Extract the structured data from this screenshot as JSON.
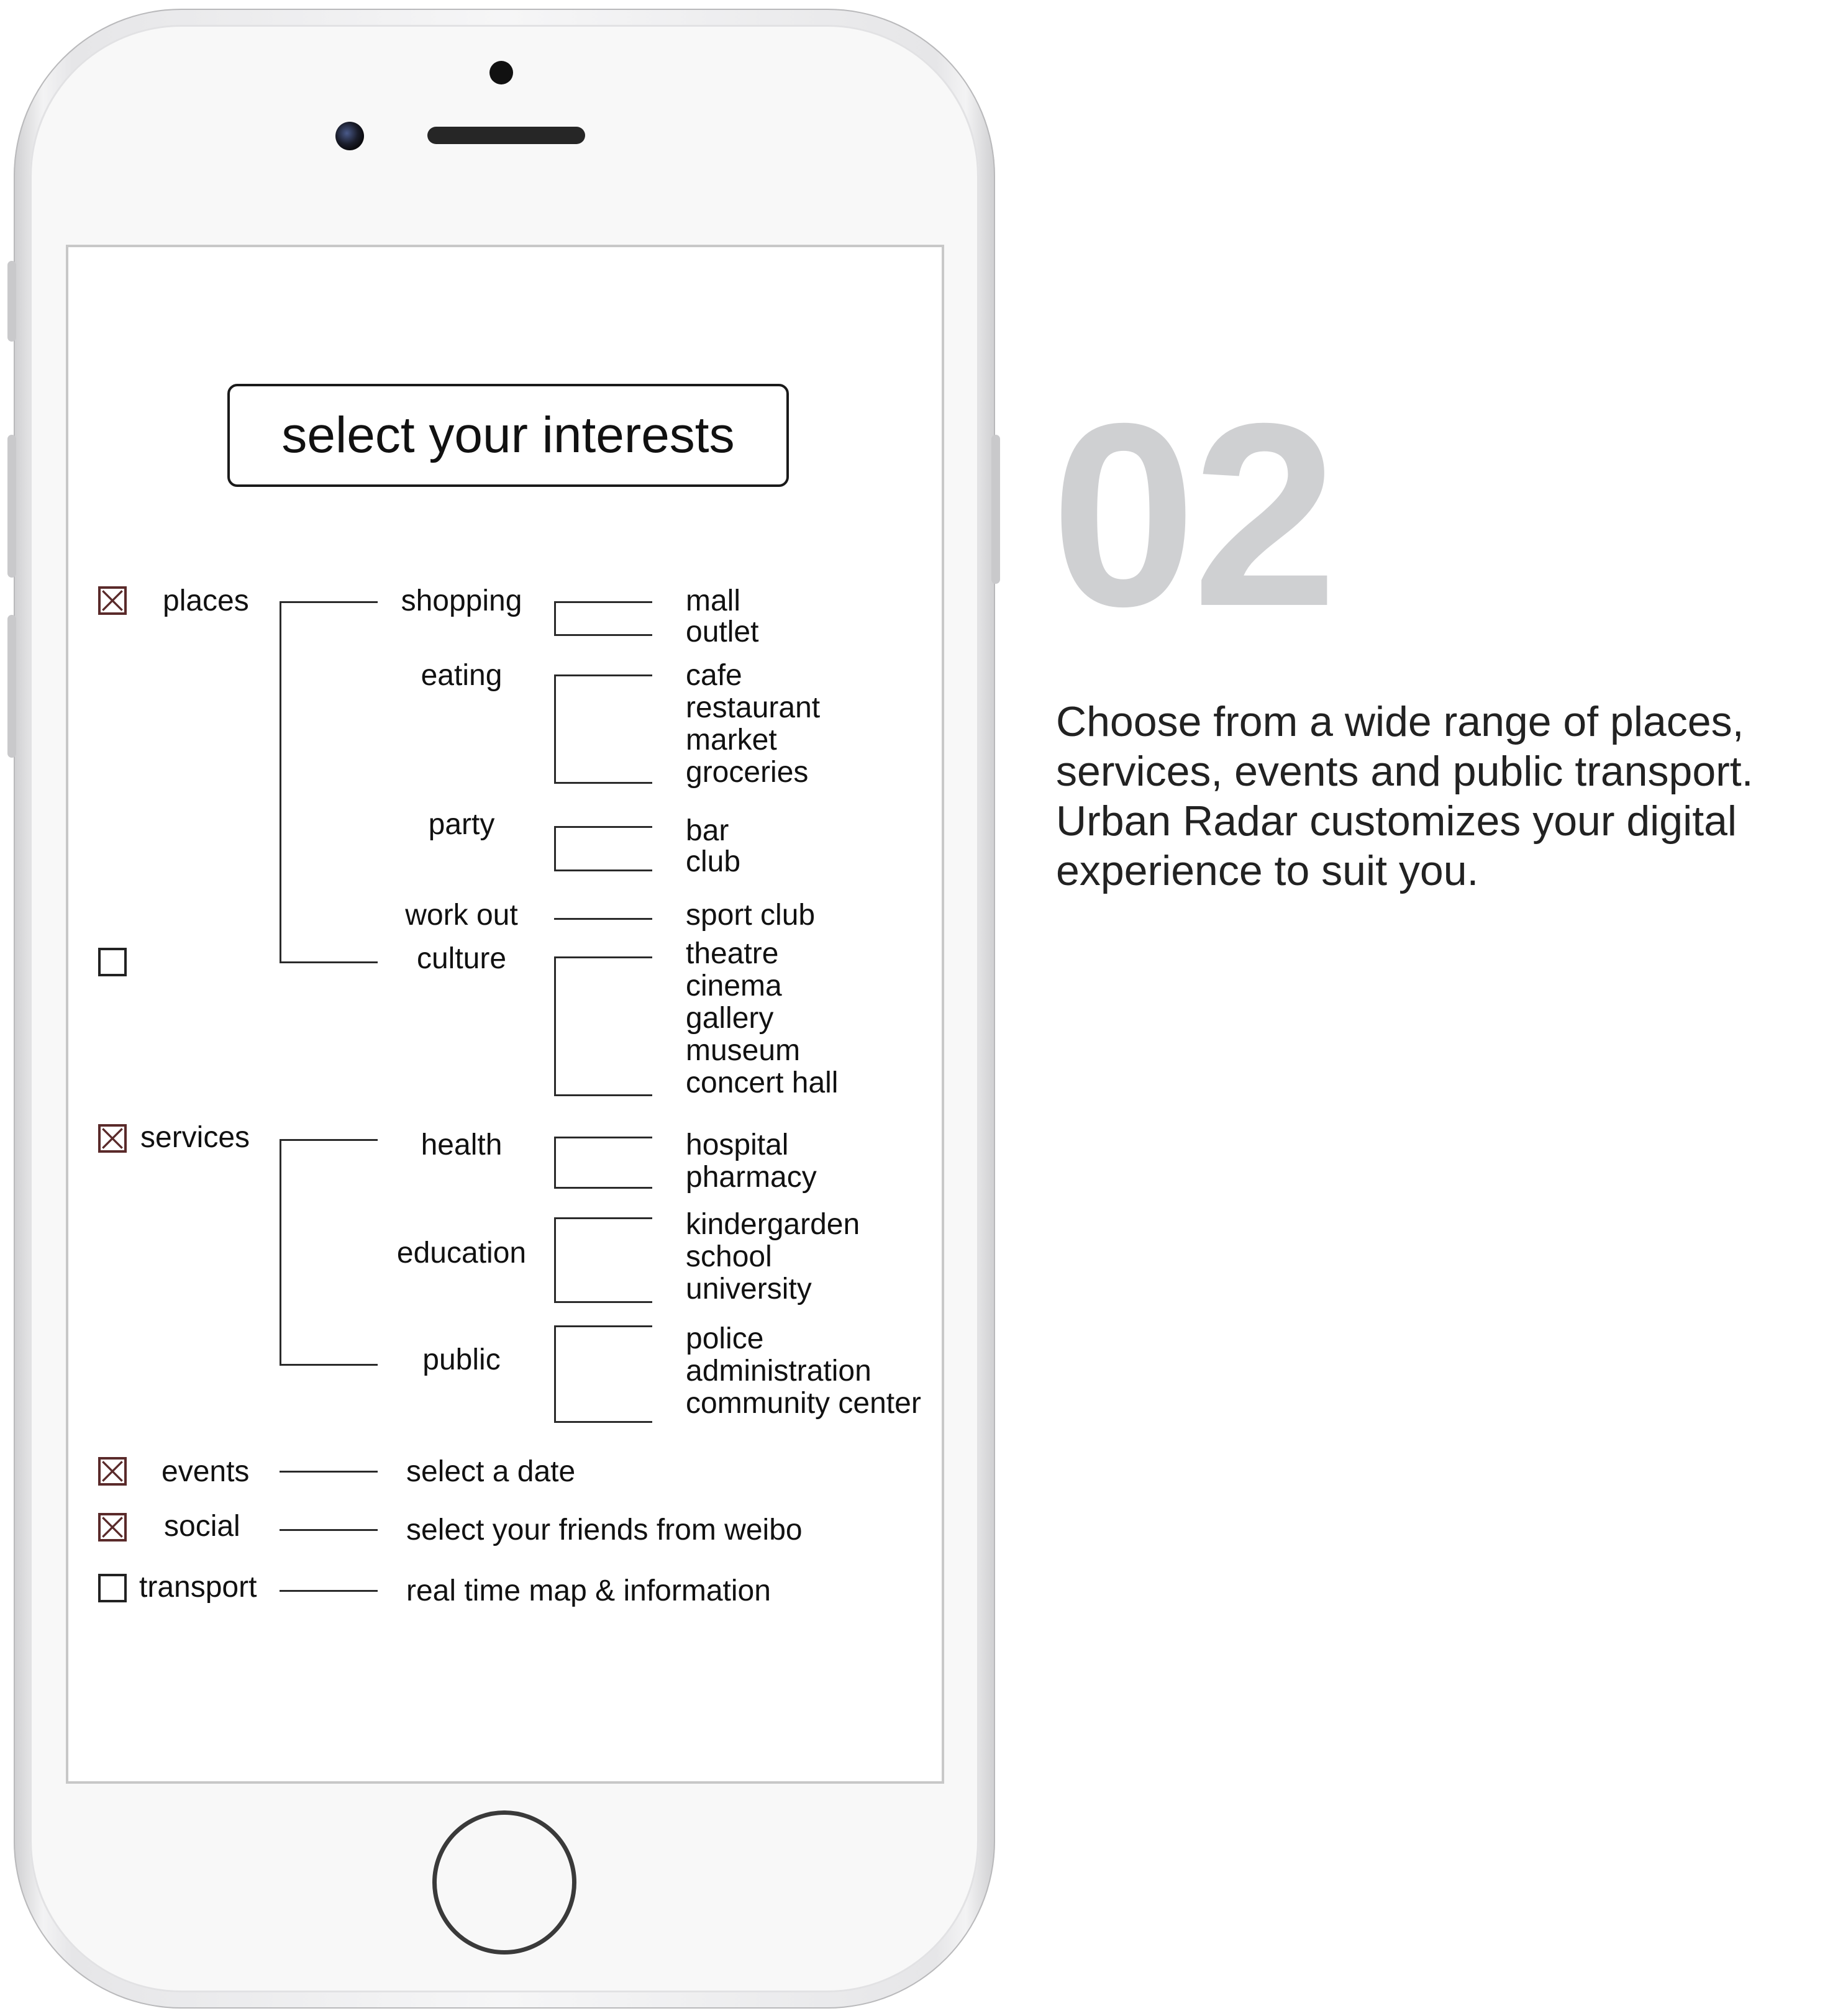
{
  "screen": {
    "title": "select your interests",
    "categories": [
      {
        "label": "places",
        "checked": true,
        "subcategories": [
          {
            "label": "shopping",
            "items": [
              "mall",
              "outlet"
            ]
          },
          {
            "label": "eating",
            "items": [
              "cafe",
              "restaurant",
              "market",
              "groceries"
            ]
          },
          {
            "label": "party",
            "items": [
              "bar",
              "club"
            ]
          },
          {
            "label": "work out",
            "items": [
              "sport club"
            ]
          },
          {
            "label": "culture",
            "items": [
              "theatre",
              "cinema",
              "gallery",
              "museum",
              "concert hall"
            ]
          }
        ]
      },
      {
        "label": "",
        "checked": false
      },
      {
        "label": "services",
        "checked": true,
        "subcategories": [
          {
            "label": "health",
            "items": [
              "hospital",
              "pharmacy"
            ]
          },
          {
            "label": "education",
            "items": [
              "kindergarden",
              "school",
              "university"
            ]
          },
          {
            "label": "public",
            "items": [
              "police",
              "administration",
              "community center"
            ]
          }
        ]
      },
      {
        "label": "events",
        "checked": true,
        "detail": "select a date"
      },
      {
        "label": "social",
        "checked": true,
        "detail": "select your friends from weibo"
      },
      {
        "label": "transport",
        "checked": false,
        "detail": "real time map & information"
      }
    ]
  },
  "side": {
    "step_number": "02",
    "description": "Choose from a wide range of places, services, events and public transport. Urban Radar customizes your digital experience to suit you."
  },
  "colors": {
    "step_number": "#cfd0d2",
    "text": "#111111",
    "checkbox_x": "#5a2a2a"
  }
}
